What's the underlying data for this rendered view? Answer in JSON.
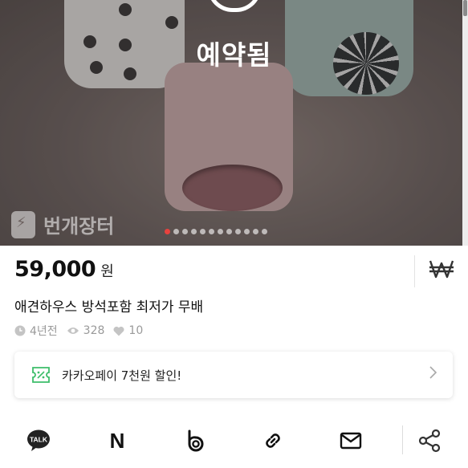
{
  "product": {
    "status_overlay": "예약됨",
    "watermark": "번개장터",
    "image_count": 12,
    "active_image_index": 0,
    "price": "59,000",
    "currency": "원",
    "won_icon": "won-sign-icon",
    "title": "애견하우스 방석포함 최저가 무배",
    "time_ago": "4년전",
    "views": "328",
    "likes": "10"
  },
  "promo": {
    "text": "카카오페이 7천원 할인!",
    "icon": "coupon-icon"
  },
  "share": {
    "talk_label": "TALK",
    "naver_label": "N",
    "icons": [
      "kakaotalk-icon",
      "naver-icon",
      "band-icon",
      "link-icon",
      "mail-icon",
      "share-icon"
    ]
  },
  "colors": {
    "accent": "#e8423e",
    "promo_green": "#3dbd6a"
  }
}
